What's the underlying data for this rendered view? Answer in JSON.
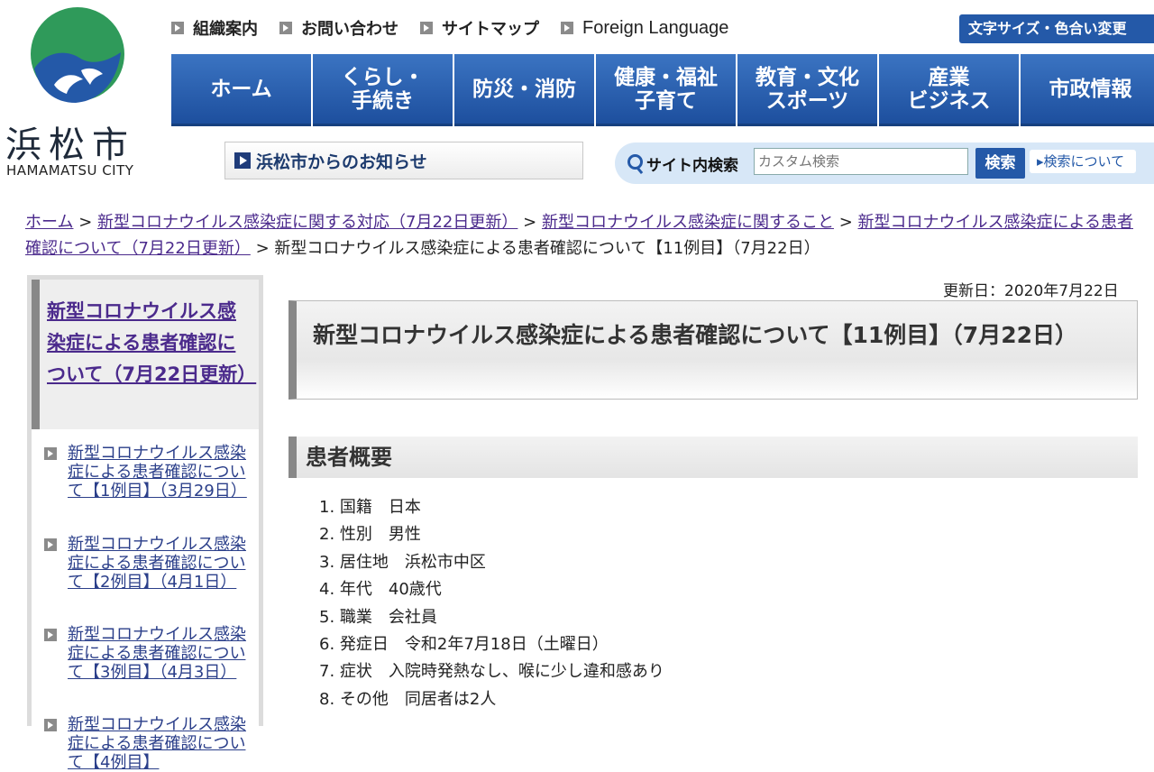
{
  "logo": {
    "city_jp": "浜松市",
    "city_en": "HAMAMATSU CITY",
    "colors": {
      "green": "#2f9a5a",
      "blue": "#2459a8"
    }
  },
  "top_links": [
    "組織案内",
    "お問い合わせ",
    "サイトマップ",
    "Foreign Language"
  ],
  "font_color_button": "文字サイズ・色合い変更",
  "main_nav": [
    "ホーム",
    "くらし・\n手続き",
    "防災・消防",
    "健康・福祉\n子育て",
    "教育・文化\nスポーツ",
    "産業\nビジネス",
    "市政情報"
  ],
  "notice_banner": "浜松市からのお知らせ",
  "search": {
    "label": "サイト内検索",
    "placeholder": "カスタム検索",
    "button": "検索",
    "about_link": "▸検索について"
  },
  "breadcrumb": {
    "links": [
      "ホーム",
      "新型コロナウイルス感染症に関する対応（7月22日更新）",
      "新型コロナウイルス感染症に関すること",
      "新型コロナウイルス感染症による患者確認について（7月22日更新）"
    ],
    "current": "新型コロナウイルス感染症による患者確認について【11例目】（7月22日）",
    "separator": ">"
  },
  "sidebar": {
    "heading": "新型コロナウイルス感染症による患者確認について（7月22日更新）",
    "items": [
      "新型コロナウイルス感染症による患者確認について【1例目】（3月29日）",
      "新型コロナウイルス感染症による患者確認について【2例目】（4月1日）",
      "新型コロナウイルス感染症による患者確認について【3例目】（4月3日）",
      "新型コロナウイルス感染症による患者確認について【4例目】"
    ]
  },
  "main": {
    "updated": "更新日：2020年7月22日",
    "title": "新型コロナウイルス感染症による患者確認について【11例目】（7月22日）",
    "section_heading": "患者概要",
    "details": [
      "1. 国籍　日本",
      "2. 性別　男性",
      "3. 居住地　浜松市中区",
      "4. 年代　40歳代",
      "5. 職業　会社員",
      "6. 発症日　令和2年7月18日（土曜日）",
      "7. 症状　入院時発熱なし、喉に少し違和感あり",
      "8. その他　同居者は2人"
    ]
  },
  "colors": {
    "nav_blue": "#2459a8",
    "link_purple": "#4b2a8c",
    "link_blue": "#2b3f8a"
  }
}
